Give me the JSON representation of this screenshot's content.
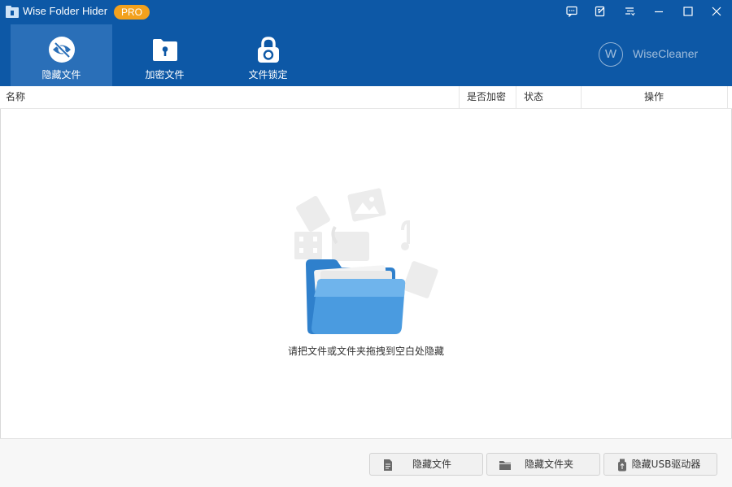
{
  "window": {
    "app_title": "Wise Folder Hider",
    "badge": "PRO"
  },
  "window_controls": [
    {
      "icon": "feedback-icon"
    },
    {
      "icon": "edit-icon"
    },
    {
      "icon": "menu-icon"
    },
    {
      "icon": "minimize-icon"
    },
    {
      "icon": "maximize-icon"
    },
    {
      "icon": "close-icon"
    }
  ],
  "nav": {
    "tabs": [
      {
        "label": "隐藏文件",
        "icon": "eye-slash-icon",
        "active": true
      },
      {
        "label": "加密文件",
        "icon": "folder-lock-icon",
        "active": false
      },
      {
        "label": "文件锁定",
        "icon": "padlock-icon",
        "active": false
      }
    ]
  },
  "brand": {
    "logo_letter": "W",
    "name": "WiseCleaner"
  },
  "table": {
    "columns": [
      "名称",
      "是否加密",
      "状态",
      "操作"
    ]
  },
  "empty_state": {
    "hint": "请把文件或文件夹拖拽到空白处隐藏",
    "icon": "open-folder-icon"
  },
  "footer": {
    "buttons": [
      {
        "label": "隐藏文件",
        "icon": "file-icon"
      },
      {
        "label": "隐藏文件夹",
        "icon": "folder-icon"
      },
      {
        "label": "隐藏USB驱动器",
        "icon": "usb-drive-icon"
      }
    ]
  },
  "colors": {
    "header": "#0d58a6",
    "active_tab": "#2a6fb8",
    "badge": "#f3a11d",
    "folder": "#4a9be0"
  }
}
